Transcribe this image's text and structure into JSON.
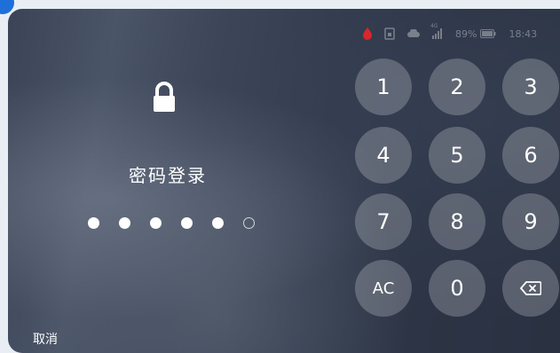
{
  "status_bar": {
    "signal_label": "4G",
    "battery_percent": "89%",
    "time": "18:43",
    "icons": [
      "drop-icon",
      "sim-icon",
      "cloud-icon",
      "signal-icon",
      "battery-icon"
    ],
    "drop_color": "#d8262b"
  },
  "login": {
    "title": "密码登录",
    "pin_length": 6,
    "pin_filled": 5
  },
  "keypad": {
    "keys": [
      "1",
      "2",
      "3",
      "4",
      "5",
      "6",
      "7",
      "8",
      "9",
      "AC",
      "0",
      "backspace"
    ]
  },
  "footer": {
    "cancel_label": "取消"
  },
  "colors": {
    "accent": "#1e6fd9",
    "key_bg": "rgba(255,255,255,0.22)"
  }
}
